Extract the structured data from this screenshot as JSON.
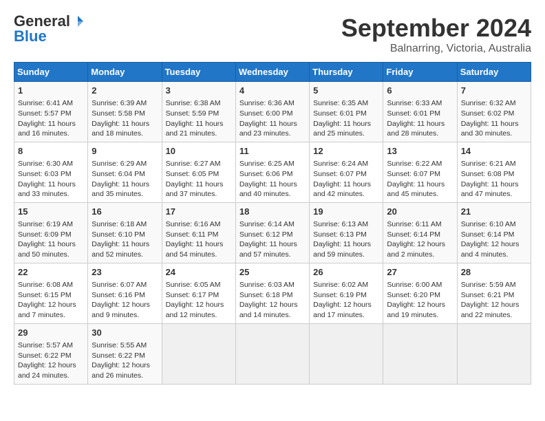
{
  "header": {
    "logo_general": "General",
    "logo_blue": "Blue",
    "month_title": "September 2024",
    "location": "Balnarring, Victoria, Australia"
  },
  "weekdays": [
    "Sunday",
    "Monday",
    "Tuesday",
    "Wednesday",
    "Thursday",
    "Friday",
    "Saturday"
  ],
  "weeks": [
    [
      {
        "day": "1",
        "lines": [
          "Sunrise: 6:41 AM",
          "Sunset: 5:57 PM",
          "Daylight: 11 hours",
          "and 16 minutes."
        ]
      },
      {
        "day": "2",
        "lines": [
          "Sunrise: 6:39 AM",
          "Sunset: 5:58 PM",
          "Daylight: 11 hours",
          "and 18 minutes."
        ]
      },
      {
        "day": "3",
        "lines": [
          "Sunrise: 6:38 AM",
          "Sunset: 5:59 PM",
          "Daylight: 11 hours",
          "and 21 minutes."
        ]
      },
      {
        "day": "4",
        "lines": [
          "Sunrise: 6:36 AM",
          "Sunset: 6:00 PM",
          "Daylight: 11 hours",
          "and 23 minutes."
        ]
      },
      {
        "day": "5",
        "lines": [
          "Sunrise: 6:35 AM",
          "Sunset: 6:01 PM",
          "Daylight: 11 hours",
          "and 25 minutes."
        ]
      },
      {
        "day": "6",
        "lines": [
          "Sunrise: 6:33 AM",
          "Sunset: 6:01 PM",
          "Daylight: 11 hours",
          "and 28 minutes."
        ]
      },
      {
        "day": "7",
        "lines": [
          "Sunrise: 6:32 AM",
          "Sunset: 6:02 PM",
          "Daylight: 11 hours",
          "and 30 minutes."
        ]
      }
    ],
    [
      {
        "day": "8",
        "lines": [
          "Sunrise: 6:30 AM",
          "Sunset: 6:03 PM",
          "Daylight: 11 hours",
          "and 33 minutes."
        ]
      },
      {
        "day": "9",
        "lines": [
          "Sunrise: 6:29 AM",
          "Sunset: 6:04 PM",
          "Daylight: 11 hours",
          "and 35 minutes."
        ]
      },
      {
        "day": "10",
        "lines": [
          "Sunrise: 6:27 AM",
          "Sunset: 6:05 PM",
          "Daylight: 11 hours",
          "and 37 minutes."
        ]
      },
      {
        "day": "11",
        "lines": [
          "Sunrise: 6:25 AM",
          "Sunset: 6:06 PM",
          "Daylight: 11 hours",
          "and 40 minutes."
        ]
      },
      {
        "day": "12",
        "lines": [
          "Sunrise: 6:24 AM",
          "Sunset: 6:07 PM",
          "Daylight: 11 hours",
          "and 42 minutes."
        ]
      },
      {
        "day": "13",
        "lines": [
          "Sunrise: 6:22 AM",
          "Sunset: 6:07 PM",
          "Daylight: 11 hours",
          "and 45 minutes."
        ]
      },
      {
        "day": "14",
        "lines": [
          "Sunrise: 6:21 AM",
          "Sunset: 6:08 PM",
          "Daylight: 11 hours",
          "and 47 minutes."
        ]
      }
    ],
    [
      {
        "day": "15",
        "lines": [
          "Sunrise: 6:19 AM",
          "Sunset: 6:09 PM",
          "Daylight: 11 hours",
          "and 50 minutes."
        ]
      },
      {
        "day": "16",
        "lines": [
          "Sunrise: 6:18 AM",
          "Sunset: 6:10 PM",
          "Daylight: 11 hours",
          "and 52 minutes."
        ]
      },
      {
        "day": "17",
        "lines": [
          "Sunrise: 6:16 AM",
          "Sunset: 6:11 PM",
          "Daylight: 11 hours",
          "and 54 minutes."
        ]
      },
      {
        "day": "18",
        "lines": [
          "Sunrise: 6:14 AM",
          "Sunset: 6:12 PM",
          "Daylight: 11 hours",
          "and 57 minutes."
        ]
      },
      {
        "day": "19",
        "lines": [
          "Sunrise: 6:13 AM",
          "Sunset: 6:13 PM",
          "Daylight: 11 hours",
          "and 59 minutes."
        ]
      },
      {
        "day": "20",
        "lines": [
          "Sunrise: 6:11 AM",
          "Sunset: 6:14 PM",
          "Daylight: 12 hours",
          "and 2 minutes."
        ]
      },
      {
        "day": "21",
        "lines": [
          "Sunrise: 6:10 AM",
          "Sunset: 6:14 PM",
          "Daylight: 12 hours",
          "and 4 minutes."
        ]
      }
    ],
    [
      {
        "day": "22",
        "lines": [
          "Sunrise: 6:08 AM",
          "Sunset: 6:15 PM",
          "Daylight: 12 hours",
          "and 7 minutes."
        ]
      },
      {
        "day": "23",
        "lines": [
          "Sunrise: 6:07 AM",
          "Sunset: 6:16 PM",
          "Daylight: 12 hours",
          "and 9 minutes."
        ]
      },
      {
        "day": "24",
        "lines": [
          "Sunrise: 6:05 AM",
          "Sunset: 6:17 PM",
          "Daylight: 12 hours",
          "and 12 minutes."
        ]
      },
      {
        "day": "25",
        "lines": [
          "Sunrise: 6:03 AM",
          "Sunset: 6:18 PM",
          "Daylight: 12 hours",
          "and 14 minutes."
        ]
      },
      {
        "day": "26",
        "lines": [
          "Sunrise: 6:02 AM",
          "Sunset: 6:19 PM",
          "Daylight: 12 hours",
          "and 17 minutes."
        ]
      },
      {
        "day": "27",
        "lines": [
          "Sunrise: 6:00 AM",
          "Sunset: 6:20 PM",
          "Daylight: 12 hours",
          "and 19 minutes."
        ]
      },
      {
        "day": "28",
        "lines": [
          "Sunrise: 5:59 AM",
          "Sunset: 6:21 PM",
          "Daylight: 12 hours",
          "and 22 minutes."
        ]
      }
    ],
    [
      {
        "day": "29",
        "lines": [
          "Sunrise: 5:57 AM",
          "Sunset: 6:22 PM",
          "Daylight: 12 hours",
          "and 24 minutes."
        ]
      },
      {
        "day": "30",
        "lines": [
          "Sunrise: 5:55 AM",
          "Sunset: 6:22 PM",
          "Daylight: 12 hours",
          "and 26 minutes."
        ]
      },
      {
        "day": "",
        "lines": []
      },
      {
        "day": "",
        "lines": []
      },
      {
        "day": "",
        "lines": []
      },
      {
        "day": "",
        "lines": []
      },
      {
        "day": "",
        "lines": []
      }
    ]
  ]
}
